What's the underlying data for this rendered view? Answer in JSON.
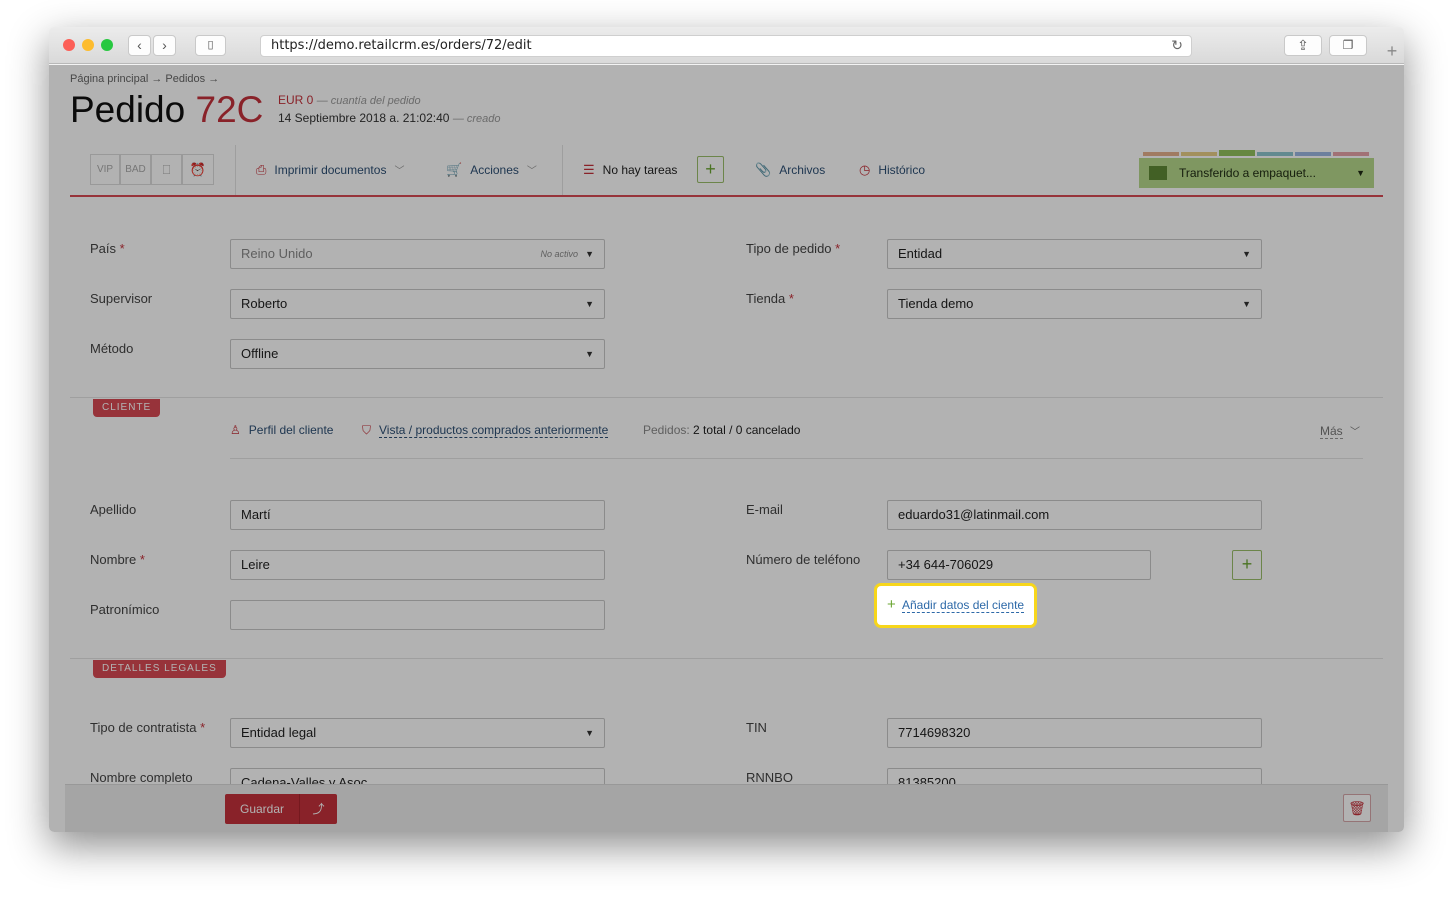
{
  "browser": {
    "url": "https://demo.retailcrm.es/orders/72/edit",
    "new_tab": "+"
  },
  "header": {
    "breadcrumb": "Página principal → Pedidos →",
    "title": "Pedido",
    "number": "72C",
    "amount": "EUR 0",
    "amount_note": "— cuantía del pedido",
    "created": "14 Septiembre 2018 a. 21:02:40",
    "created_note": "— creado"
  },
  "toolbar": {
    "vip": "VIP",
    "bad": "BAD",
    "print": "Imprimir documentos",
    "actions": "Acciones",
    "tasks": "No hay tareas",
    "files": "Archivos",
    "history": "Histórico",
    "status": "Transferido a empaquet...",
    "colors": {
      "accent": "#c5323b",
      "status_bg": "#b7d98b"
    }
  },
  "order": {
    "country_label": "País",
    "country_value": "Reino Unido",
    "country_note": "No activo",
    "supervisor_label": "Supervisor",
    "supervisor_value": "Roberto",
    "method_label": "Método",
    "method_value": "Offline",
    "type_label": "Tipo de pedido",
    "type_value": "Entidad",
    "store_label": "Tienda",
    "store_value": "Tienda demo"
  },
  "client": {
    "section": "CLIENTE",
    "profile": "Perfil del cliente",
    "purchased": "Vista / productos comprados anteriormente",
    "orders_label": "Pedidos:",
    "orders_value": "2 total / 0 cancelado",
    "more": "Más",
    "lastname_label": "Apellido",
    "lastname_value": "Martí",
    "firstname_label": "Nombre",
    "firstname_value": "Leire",
    "patronymic_label": "Patronímico",
    "patronymic_value": "",
    "email_label": "E-mail",
    "email_value": "eduardo31@latinmail.com",
    "phone_label": "Número de teléfono",
    "phone_value": "+34 644-706029",
    "add_data": "Añadir datos del ciente"
  },
  "legal": {
    "section": "DETALLES LEGALES",
    "contractor_label": "Tipo de contratista",
    "contractor_value": "Entidad legal",
    "fullname_label": "Nombre completo",
    "fullname_value": "Cadena-Valles y Asoc.",
    "tin_label": "TIN",
    "tin_value": "7714698320",
    "rnnbo_label": "RNNBO",
    "rnnbo_value": "81385200"
  },
  "footer": {
    "save": "Guardar"
  }
}
